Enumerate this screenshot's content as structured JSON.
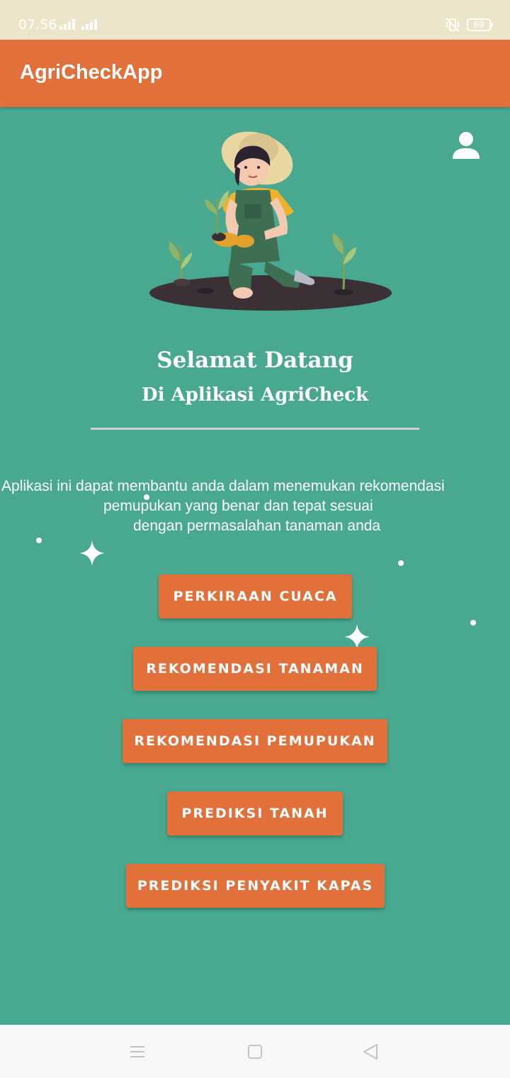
{
  "status_bar": {
    "time": "07.56",
    "battery": "69",
    "icons": [
      "signal-icon",
      "signal-icon",
      "vibrate-icon",
      "battery-icon"
    ]
  },
  "app_bar": {
    "title": "AgriCheckApp",
    "icons": [
      "profile-icon"
    ]
  },
  "welcome": {
    "title": "Selamat Datang",
    "subtitle": "Di Aplikasi AgriCheck"
  },
  "description": {
    "line1": "Aplikasi ini dapat membantu anda dalam menemukan rekomendasi",
    "line2": "pemupukan yang benar dan tepat sesuai",
    "line3": "dengan permasalahan tanaman anda"
  },
  "menu": {
    "buttons": [
      {
        "label": "PERKIRAAN CUACA"
      },
      {
        "label": "REKOMENDASI TANAMAN"
      },
      {
        "label": "REKOMENDASI PEMUPUKAN"
      },
      {
        "label": "PREDIKSI TANAH"
      },
      {
        "label": "PREDIKSI PENYAKIT KAPAS"
      }
    ]
  },
  "nav_bar": {
    "icons": [
      "menu-icon",
      "home-square-icon",
      "back-triangle-icon"
    ]
  },
  "colors": {
    "background": "#48a990",
    "accent": "#e1703a",
    "status_bar": "#ede5c9",
    "nav_bar": "#f7f7f7"
  }
}
